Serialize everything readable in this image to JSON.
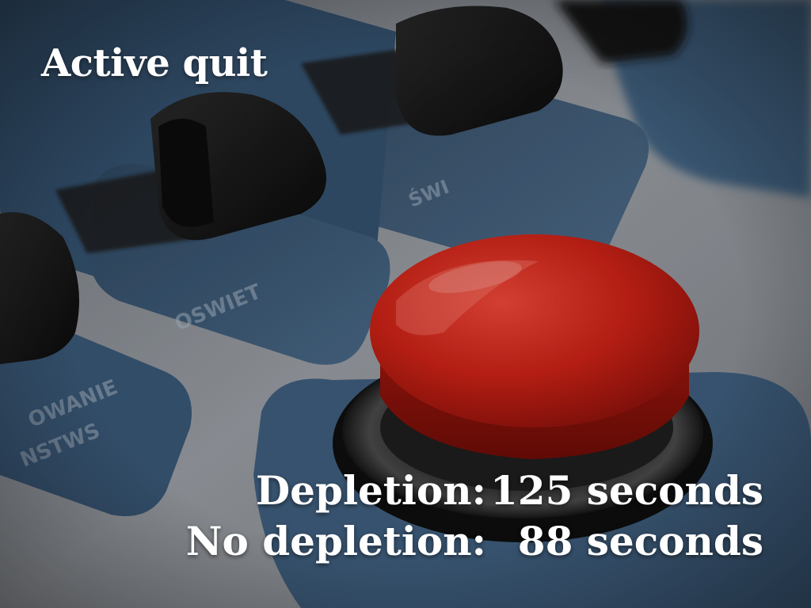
{
  "title": "Active quit",
  "stats": [
    {
      "label": "Depletion:",
      "value": "125 seconds"
    },
    {
      "label": "No depletion:",
      "value": "88 seconds"
    }
  ],
  "background": {
    "description_icon": "red-push-button-panel",
    "colors": {
      "panel_blue": "#3d5873",
      "panel_gray": "#8a8f96",
      "button_red": "#c41e14",
      "knob_black": "#141414"
    }
  }
}
